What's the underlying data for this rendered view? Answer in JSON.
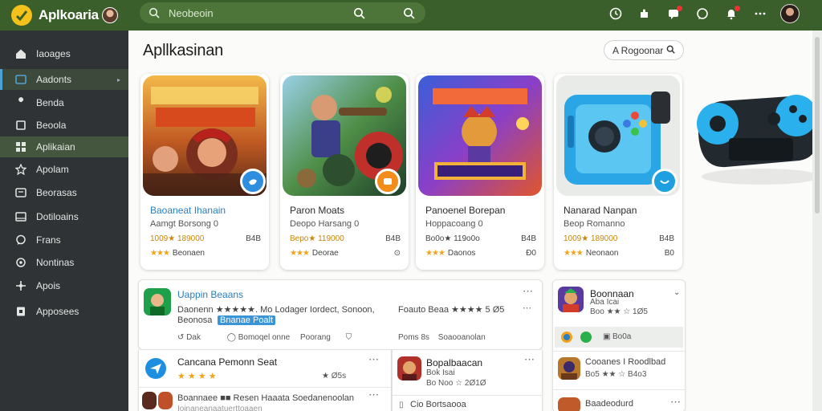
{
  "app": {
    "name": "Aplkoaria"
  },
  "search": {
    "placeholder": "Neobeoin"
  },
  "sidebar": {
    "items": [
      {
        "label": "Iaoages",
        "icon": "home-icon"
      },
      {
        "label": "Aadonts",
        "icon": "apps-icon"
      },
      {
        "label": "Benda",
        "icon": "wrench-icon"
      },
      {
        "label": "Beoola",
        "icon": "book-icon"
      },
      {
        "label": "Aplikaian",
        "icon": "grid-icon"
      },
      {
        "label": "Apolam",
        "icon": "star-icon"
      },
      {
        "label": "Beorasas",
        "icon": "music-icon"
      },
      {
        "label": "Dotiloains",
        "icon": "film-icon"
      },
      {
        "label": "Frans",
        "icon": "chat-icon"
      },
      {
        "label": "Nontinas",
        "icon": "gear-icon"
      },
      {
        "label": "Apois",
        "icon": "puzzle-icon"
      },
      {
        "label": "Apposees",
        "icon": "upload-icon"
      }
    ]
  },
  "main": {
    "title": "Apllkasinan",
    "sort_label": "A Rogoonar",
    "cards": [
      {
        "title": "Baoaneat Ihanain",
        "subtitle": "Aamgt Borsong 0",
        "downloads": "1009★ 189000",
        "size": "B4B",
        "rating_label": "Beonaen",
        "rating_right": ""
      },
      {
        "title": "Paron Moats",
        "subtitle": "Deopo Harsang 0",
        "downloads": "Bepo★ 119000",
        "size": "B4B",
        "rating_label": "Deorae",
        "rating_right": "⊙"
      },
      {
        "title": "Panoenel Borepan",
        "subtitle": "Hoppacoang 0",
        "downloads": "Bo0o★ 119o0o",
        "size": "B4B",
        "rating_label": "Daonos",
        "rating_right": "Ð0"
      },
      {
        "title": "Nanarad Nanpan",
        "subtitle": "Beop Romanno",
        "downloads": "1009★ 189000",
        "size": "B4B",
        "rating_label": "Neonaon",
        "rating_right": "B0"
      }
    ],
    "featured": {
      "title": "Uappin Beaans",
      "line1": "Daonenn ★★★★★. Mo Lodager Iordect, Sonoon,",
      "line2": "Beonosa",
      "link": "Bnanae Poalt",
      "meta_a": "Dak",
      "meta_b": "Bomoqel onne",
      "meta_c": "Poorang",
      "side_line": "Foauto Beaa ★★★★ 5 Ø5",
      "side_meta_a": "Poms 8s",
      "side_meta_b": "Soaooanolan"
    },
    "list_left": [
      {
        "title": "Cancana Pemonn Seat",
        "meta": "★ Ø5s"
      },
      {
        "title": "Boannaee ■■ Resen Haaata Soedanenoolan",
        "sub": "Ioinaneanaatuerttoaaen"
      }
    ],
    "list_mid": [
      {
        "title": "Bopalbaacan",
        "sub": "Bok Isai",
        "meta": "Bo Noo ☆ 2Ø1Ø"
      },
      {
        "title": "Cio Bortsaooa"
      }
    ],
    "right_panel": {
      "title": "Boonnaan",
      "sub": "Aba Icai",
      "meta": "Boo ★★ ☆ 1Ø5",
      "chip_a": "",
      "chip_b": "",
      "chip_label": "Bo0a",
      "row2_title": "Cooanes I Roodlbad",
      "row2_meta": "Bo5 ★★ ☆ B4o3",
      "row3_title": "Baadeodurd"
    }
  },
  "colors": {
    "topbar": "#3a5f2a",
    "sidebar": "#2f3336",
    "accent_blue": "#4ea3d6",
    "star": "#f2a31a"
  }
}
